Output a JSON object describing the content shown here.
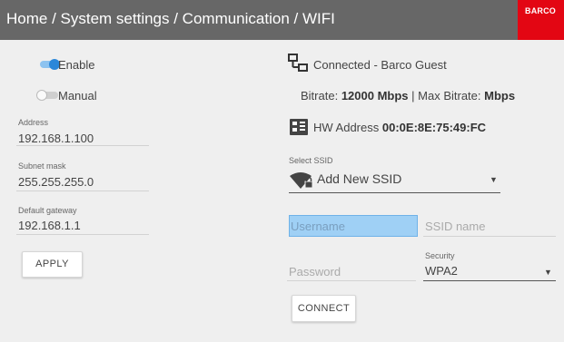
{
  "header": {
    "breadcrumb": "Home / System settings / Communication / WIFI",
    "logo_text": "BARCO"
  },
  "left": {
    "enable_toggle": {
      "label": "Enable",
      "state": "on"
    },
    "manual_toggle": {
      "label": "Manual",
      "state": "off"
    },
    "address": {
      "label": "Address",
      "value": "192.168.1.100"
    },
    "subnet_mask": {
      "label": "Subnet mask",
      "value": "255.255.255.0"
    },
    "default_gateway": {
      "label": "Default gateway",
      "value": "192.168.1.1"
    },
    "apply_button": "APPLY"
  },
  "right": {
    "connection_status": "Connected - Barco Guest",
    "bitrate_label": "Bitrate:",
    "bitrate_value": "12000 Mbps",
    "separator": "|",
    "max_bitrate_label": "Max Bitrate:",
    "max_bitrate_unit": "Mbps",
    "hw_address_label": "HW Address",
    "hw_address_value": "00:0E:8E:75:49:FC",
    "select_ssid": {
      "label": "Select SSID",
      "value": "Add New SSID"
    },
    "username_placeholder": "Username",
    "ssid_name_placeholder": "SSID name",
    "password_placeholder": "Password",
    "security": {
      "label": "Security",
      "value": "WPA2"
    },
    "connect_button": "CONNECT"
  },
  "colors": {
    "header_bg": "#676767",
    "brand_red": "#e30613",
    "toggle_on": "#2b87d9",
    "focus_field": "#9fd0f5",
    "page_bg": "#efefef"
  },
  "icons": [
    "network-icon",
    "hw-chip-icon",
    "wifi-lock-icon",
    "dropdown-caret-icon"
  ]
}
